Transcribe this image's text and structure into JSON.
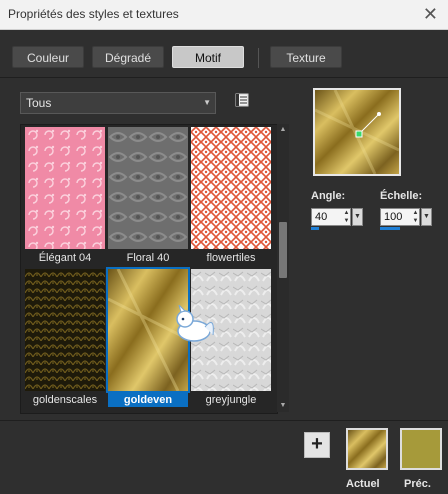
{
  "window": {
    "title": "Propriétés des styles et textures",
    "close_glyph": "✕"
  },
  "tabs": [
    {
      "label": "Couleur",
      "active": false
    },
    {
      "label": "Dégradé",
      "active": false
    },
    {
      "label": "Motif",
      "active": true
    },
    {
      "label": "Texture",
      "active": false
    }
  ],
  "category": {
    "selected": "Tous"
  },
  "patterns": [
    {
      "name": "Élégant 04",
      "selected": false
    },
    {
      "name": "Floral 40",
      "selected": false
    },
    {
      "name": "flowertiles",
      "selected": false
    },
    {
      "name": "goldenscales",
      "selected": false
    },
    {
      "name": "goldeven",
      "selected": true
    },
    {
      "name": "greyjungle",
      "selected": false
    }
  ],
  "controls": {
    "angle": {
      "label": "Angle:",
      "value": "40"
    },
    "scale": {
      "label": "Échelle:",
      "value": "100"
    }
  },
  "footer": {
    "add_glyph": "+",
    "current_label": "Actuel",
    "previous_label": "Préc.",
    "previous_color": "#a69a3a"
  },
  "colors": {
    "accent": "#0a6fc2",
    "gold": "#b89a3a",
    "pink": "#f08aa6"
  }
}
